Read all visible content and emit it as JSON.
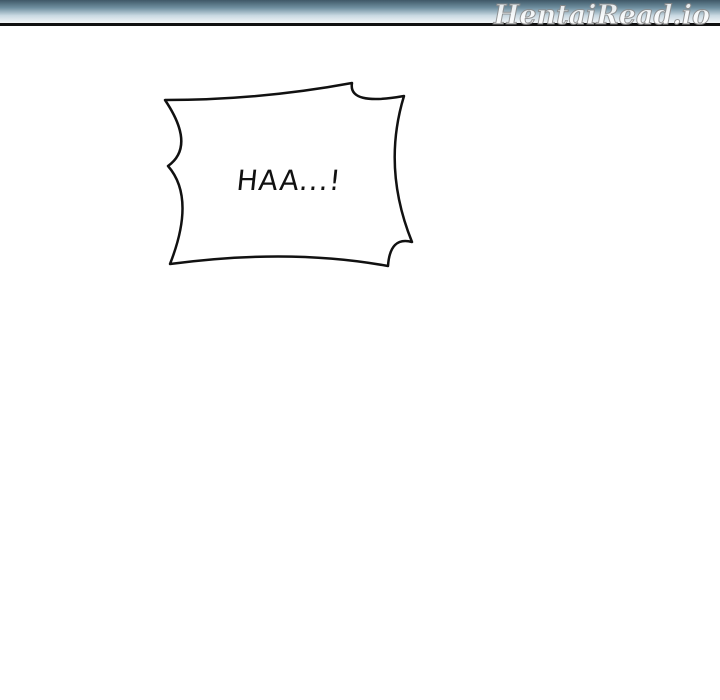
{
  "watermark": {
    "text": "HentaiRead.io"
  },
  "speech_bubble": {
    "text": "HAA...!"
  }
}
